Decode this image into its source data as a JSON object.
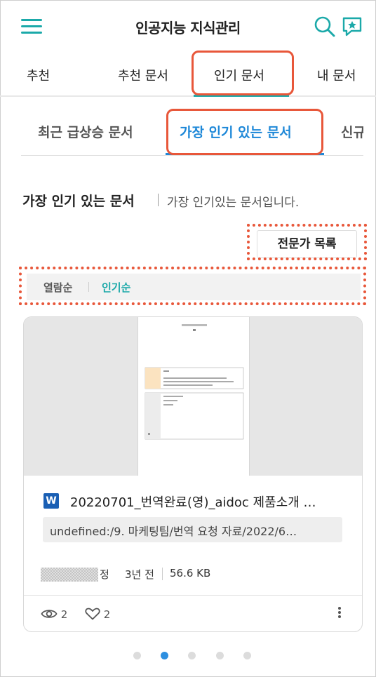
{
  "header": {
    "title": "인공지능 지식관리",
    "menu_icon": "hamburger-menu-icon",
    "search_icon": "search-icon",
    "chat_icon": "chat-star-icon",
    "accent_color": "#1ba9a9"
  },
  "main_tabs": [
    {
      "label": "추천"
    },
    {
      "label": "추천 문서"
    },
    {
      "label": "인기 문서"
    },
    {
      "label": "내 문서"
    }
  ],
  "main_tabs_active": "인기 문서",
  "sub_tabs": [
    {
      "label": "최근 급상승 문서"
    },
    {
      "label": "가장 인기 있는 문서"
    },
    {
      "label": "신규"
    }
  ],
  "sub_tabs_active": "가장 인기 있는 문서",
  "section": {
    "title": "가장 인기 있는 문서",
    "description": "가장 인기있는 문서입니다."
  },
  "expert_button": "전문가 목록",
  "sort": {
    "options": [
      "열람순",
      "인기순"
    ],
    "active": "인기순"
  },
  "card": {
    "file_type": "W",
    "title": "20220701_번역완료(영)_aidoc 제품소개 …",
    "path": "undefined:/9. 마케팅팀/번역 요청 자료/2022/6…",
    "author_suffix": "정",
    "time": "3년 전",
    "size": "56.6 KB",
    "views": "2",
    "likes": "2"
  },
  "pagination": {
    "count": 5,
    "active_index": 1
  },
  "colors": {
    "highlight": "#e8573a",
    "sub_tab_active": "#1e88d8",
    "word_icon": "#1a5fb4"
  }
}
